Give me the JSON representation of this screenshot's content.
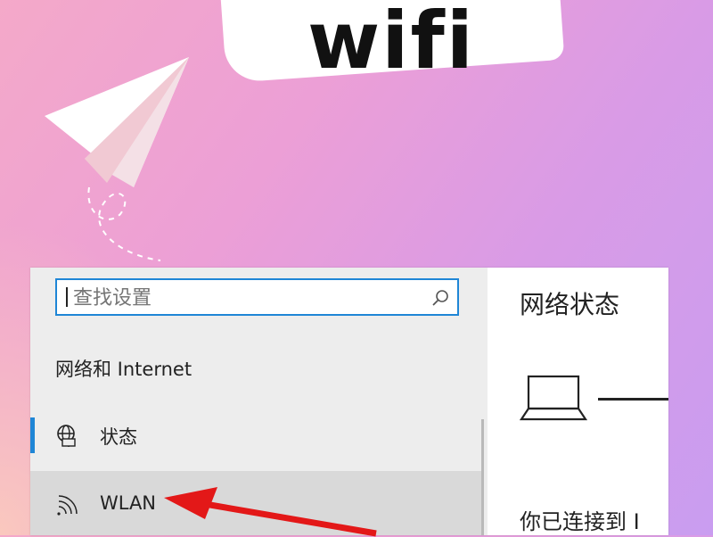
{
  "banner": {
    "title": "wifi"
  },
  "settings": {
    "search": {
      "placeholder": "查找设置",
      "icon": "search-icon"
    },
    "section_title": "网络和 Internet",
    "nav": [
      {
        "label": "状态",
        "icon": "globe-status-icon",
        "selected": false
      },
      {
        "label": "WLAN",
        "icon": "wifi-icon",
        "selected": true
      }
    ],
    "right_pane": {
      "title": "网络状态",
      "connected_text": "你已连接到 I"
    }
  },
  "colors": {
    "accent": "#1f86d6",
    "arrow": "#e31818",
    "selected_bg": "#d9d9d9",
    "pane_bg": "#ededed"
  }
}
